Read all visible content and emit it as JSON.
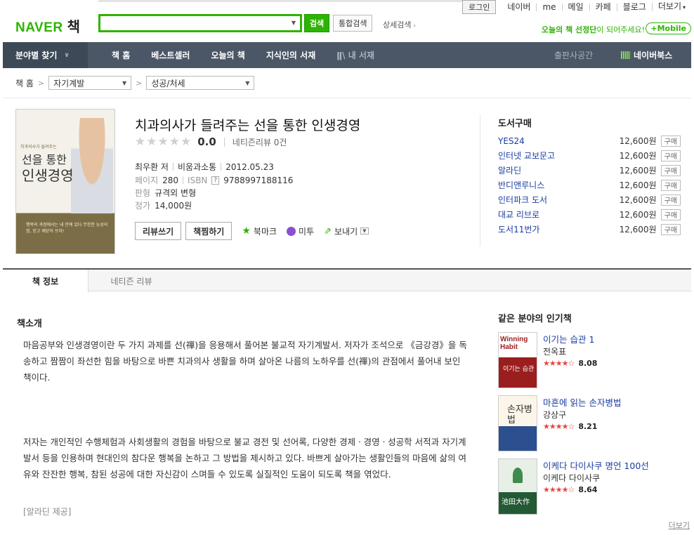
{
  "util": {
    "login": "로그인",
    "links": [
      "네이버",
      "me",
      "메일",
      "카페",
      "블로그",
      "더보기"
    ]
  },
  "header": {
    "logo": "NAVER",
    "logo_sub": "책",
    "search_value": "",
    "search_button": "검색",
    "integrated_search": "통합검색",
    "advanced_search": "상세검색",
    "promo_prefix": "오늘의 책 선정단",
    "promo_suffix": "이 되어주세요!",
    "mobile": "+Mobile"
  },
  "nav": {
    "category": "분야별 찾기",
    "items": [
      "책 홈",
      "베스트셀러",
      "오늘의 책",
      "지식인의 서재",
      "내 서재"
    ],
    "publisher": "출판사공간",
    "naverbooks": "네이버북스"
  },
  "breadcrumb": {
    "home": "책 홈",
    "level1": "자기계발",
    "level2": "성공/처세"
  },
  "book": {
    "cover_small": "치과의사가 들려주는",
    "cover_line1": "선을 통한",
    "cover_line2": "인생경영",
    "cover_blurb": "행복의 과정에서는 내 안에 있다 무한한 능성의 힘, 믿고 깨닫아 쓰자!",
    "title": "치과의사가 들려주는 선을 통한 인생경영",
    "stars": "★★★★★",
    "score": "0.0",
    "netizen_review": "네티즌리뷰 0건",
    "author": "최우환 저",
    "publisher": "비움과소통",
    "date": "2012.05.23",
    "page_label": "페이지",
    "pages": "280",
    "isbn_label": "ISBN",
    "isbn_help": "?",
    "isbn": "9788997188116",
    "format_label": "판형",
    "format": "규격외 변형",
    "price_label": "정가",
    "price": "14,000원",
    "btn_review": "리뷰쓰기",
    "btn_like": "책찜하기",
    "bookmark": "북마크",
    "mitoo": "미투",
    "send": "보내기"
  },
  "purchase": {
    "title": "도서구매",
    "buy_label": "구매",
    "stores": [
      {
        "name": "YES24",
        "price": "12,600원"
      },
      {
        "name": "인터넷 교보문고",
        "price": "12,600원"
      },
      {
        "name": "알라딘",
        "price": "12,600원"
      },
      {
        "name": "반디앤루니스",
        "price": "12,600원"
      },
      {
        "name": "인터파크 도서",
        "price": "12,600원"
      },
      {
        "name": "대교 리브로",
        "price": "12,600원"
      },
      {
        "name": "도서11번가",
        "price": "12,600원"
      }
    ]
  },
  "tabs": [
    "책 정보",
    "네티즌 리뷰"
  ],
  "intro": {
    "heading": "책소개",
    "p1": "마음공부와 인생경영이란 두 가지 과제를 선(禪)을 응용해서 풀어본 불교적 자기계발서. 저자가 조석으로 《금강경》을 독송하고 짬짬이 좌선한 힘을 바탕으로 바쁜 치과의사 생활을 하며 살아온 나름의 노하우를 선(禪)의 관점에서 풀어내 보인 책이다.",
    "p2": "저자는 개인적인 수행체험과 사회생활의 경험을 바탕으로 불교 경전 및 선어록, 다양한 경제ㆍ경영ㆍ성공학 서적과 자기계발서 등을 인용하며 현대인의 참다운 행복을 논하고 그 방법을 제시하고 있다. 바쁘게 살아가는 생활인들의 마음에 삶의 여유와 잔잔한 행복, 참된 성공에 대한 자신감이 스며들 수 있도록 실질적인 도움이 되도록 책을 엮었다.",
    "source": "[알라딘 제공]"
  },
  "popular": {
    "heading": "같은 분야의 인기책",
    "items": [
      {
        "title": "이기는 습관 1",
        "author": "전옥표",
        "stars": "★★★★☆",
        "score": "8.08",
        "thumb_text": "Winning Habit",
        "thumb_sub": "이기는 습관"
      },
      {
        "title": "마흔에 읽는 손자병법",
        "author": "강상구",
        "stars": "★★★★☆",
        "score": "8.21",
        "thumb_text": "손자병법"
      },
      {
        "title": "이케다 다이사쿠 명언 100선",
        "author": "이케다 다이사쿠",
        "stars": "★★★★☆",
        "score": "8.64",
        "thumb_text": "池田大作"
      }
    ],
    "more": "더보기"
  }
}
